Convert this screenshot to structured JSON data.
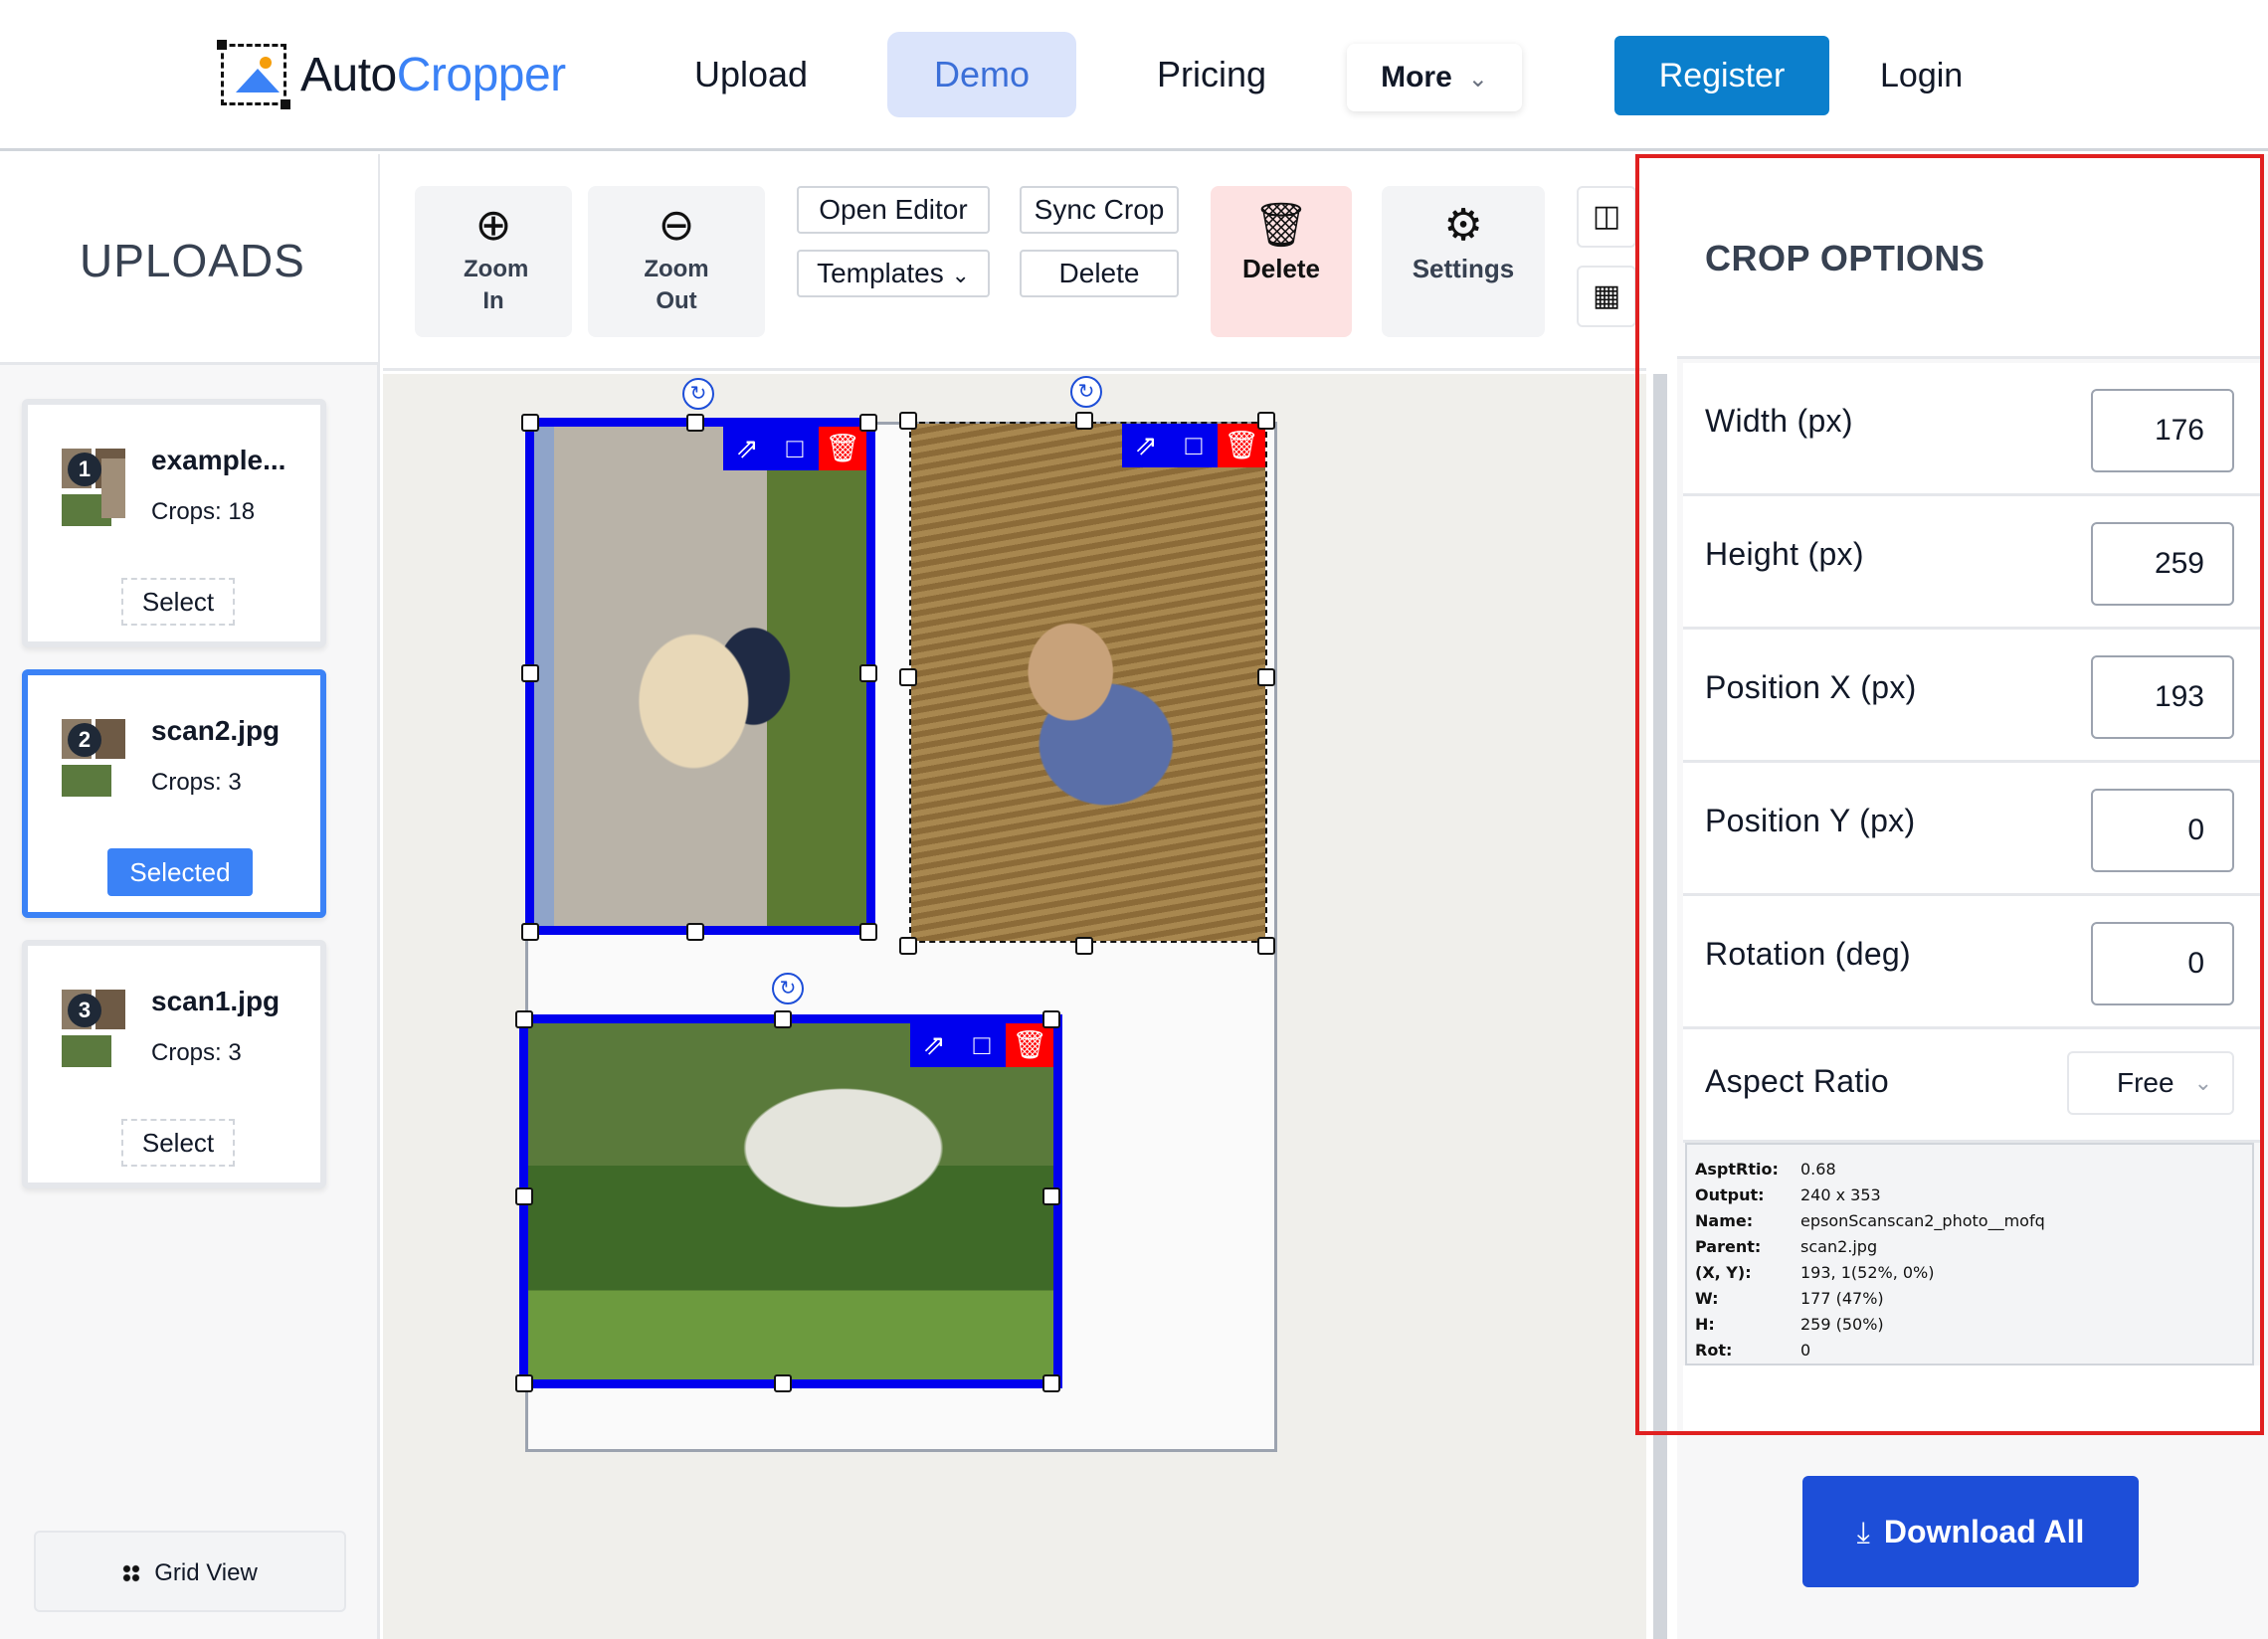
{
  "header": {
    "logo_auto": "Auto",
    "logo_cropper": "Cropper",
    "nav": [
      "Upload",
      "Demo",
      "Pricing"
    ],
    "more_label": "More",
    "register_label": "Register",
    "login_label": "Login",
    "active_nav": "Demo"
  },
  "sidebar": {
    "title": "UPLOADS",
    "cards": [
      {
        "index": "1",
        "name": "example...",
        "crops": "Crops: 18",
        "button": "Select",
        "selected": false
      },
      {
        "index": "2",
        "name": "scan2.jpg",
        "crops": "Crops: 3",
        "button": "Selected",
        "selected": true
      },
      {
        "index": "3",
        "name": "scan1.jpg",
        "crops": "Crops: 3",
        "button": "Select",
        "selected": false
      }
    ],
    "grid_view_label": "Grid View"
  },
  "toolbar": {
    "zoom_in_label": "Zoom In",
    "zoom_out_label": "Zoom Out",
    "open_editor_label": "Open Editor",
    "templates_label": "Templates",
    "sync_crop_label": "Sync Crop",
    "delete_small_label": "Delete",
    "delete_label": "Delete",
    "settings_label": "Settings"
  },
  "crop_options": {
    "title": "CROP OPTIONS",
    "fields": [
      {
        "label": "Width (px)",
        "value": "176"
      },
      {
        "label": "Height (px)",
        "value": "259"
      },
      {
        "label": "Position X (px)",
        "value": "193"
      },
      {
        "label": "Position Y (px)",
        "value": "0"
      },
      {
        "label": "Rotation (deg)",
        "value": "0"
      }
    ],
    "aspect_label": "Aspect Ratio",
    "aspect_value": "Free",
    "info": [
      {
        "key": "AsptRtio:",
        "value": "0.68"
      },
      {
        "key": "Output:",
        "value": "240 x 353"
      },
      {
        "key": "Name:",
        "value": "epsonScanscan2_photo__mofq"
      },
      {
        "key": "Parent:",
        "value": "scan2.jpg"
      },
      {
        "key": "(X, Y):",
        "value": "193, 1(52%, 0%)"
      },
      {
        "key": "W:",
        "value": "177 (47%)"
      },
      {
        "key": "H:",
        "value": "259 (50%)"
      },
      {
        "key": "Rot:",
        "value": "0"
      }
    ]
  },
  "download_label": "Download All",
  "colors": {
    "accent_blue": "#1d4ed8",
    "register_blue": "#0b7fcc",
    "crop_border": "#0000ee",
    "delete_red": "#ff0000",
    "highlight_red": "#e02020"
  },
  "icons": {
    "zoom_in": "zoom-in-icon",
    "zoom_out": "zoom-out-icon",
    "trash": "trash-icon",
    "gear": "gear-icon",
    "rotate": "rotate-icon",
    "expand": "expand-icon",
    "crop": "crop-icon",
    "download": "download-icon"
  }
}
